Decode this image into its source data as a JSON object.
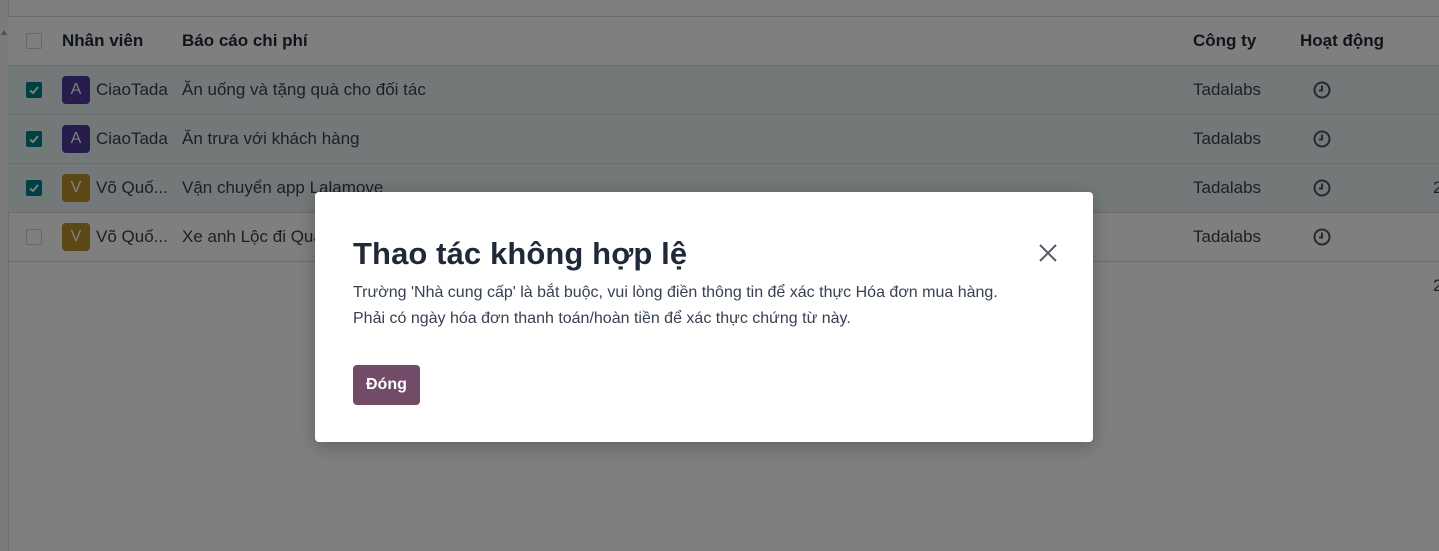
{
  "table": {
    "headers": {
      "employee": "Nhân viên",
      "report": "Báo cáo chi phí",
      "company": "Công ty",
      "activity": "Hoạt động"
    },
    "rows": [
      {
        "checked": true,
        "avatar_letter": "A",
        "avatar_color": "#4c3a9a",
        "employee": "CiaoTada",
        "report": "Ăn uống và tặng quà cho đối tác",
        "company": "Tadalabs",
        "activity_icon": "clock-icon",
        "extra": ""
      },
      {
        "checked": true,
        "avatar_letter": "A",
        "avatar_color": "#4c3a9a",
        "employee": "CiaoTada",
        "report": "Ăn trưa với khách hàng",
        "company": "Tadalabs",
        "activity_icon": "clock-icon",
        "extra": ""
      },
      {
        "checked": true,
        "avatar_letter": "V",
        "avatar_color": "#b8912a",
        "employee": "Võ Quố...",
        "report": "Vận chuyển app Lalamove",
        "company": "Tadalabs",
        "activity_icon": "clock-icon",
        "extra": "2"
      },
      {
        "checked": false,
        "avatar_letter": "V",
        "avatar_color": "#b8912a",
        "employee": "Võ Quố...",
        "report": "Xe anh Lộc đi Qua",
        "company": "Tadalabs",
        "activity_icon": "clock-icon",
        "extra": ""
      }
    ],
    "total_extra": "2"
  },
  "dialog": {
    "title": "Thao tác không hợp lệ",
    "message_line1": "Trường 'Nhà cung cấp' là bắt buộc, vui lòng điền thông tin để xác thực Hóa đơn mua hàng.",
    "message_line2": "Phải có ngày hóa đơn thanh toán/hoàn tiền để xác thực chứng từ này.",
    "close_button_label": "Đóng",
    "close_icon": "close-icon",
    "accent_color": "#714b67"
  },
  "colors": {
    "selected_row": "#e6f2f3",
    "checkbox_checked": "#017e84",
    "overlay": "rgba(0,0,0,0.5)"
  }
}
